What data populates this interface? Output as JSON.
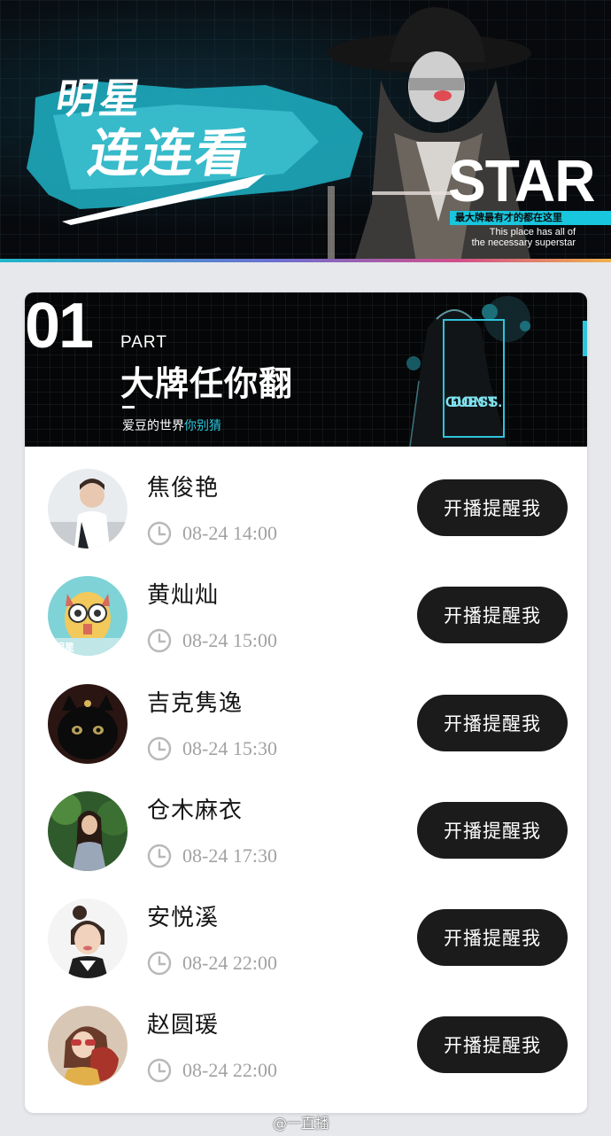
{
  "banner": {
    "title_line1": "明星",
    "title_line2": "连连看",
    "star_word": "STAR",
    "star_sub": "最大牌最有才的都在这里",
    "star_en_line1": "This place has all of",
    "star_en_line2": "the necessary superstar"
  },
  "section": {
    "number": "01",
    "part_label": "PART",
    "title": "大牌任你翻",
    "subtitle_plain": "爱豆的世界",
    "subtitle_highlight": "你别猜",
    "badge_line1": "DON'T",
    "badge_line2": "GUESS."
  },
  "remind_label": "开播提醒我",
  "schedule": [
    {
      "name": "焦俊艳",
      "time": "08-24 14:00",
      "avatar": "avatar-person-1"
    },
    {
      "name": "黄灿灿",
      "time": "08-24 15:00",
      "avatar": "avatar-owl-cartoon"
    },
    {
      "name": "吉克隽逸",
      "time": "08-24 15:30",
      "avatar": "avatar-black-cat"
    },
    {
      "name": "仓木麻衣",
      "time": "08-24 17:30",
      "avatar": "avatar-person-forest"
    },
    {
      "name": "安悦溪",
      "time": "08-24 22:00",
      "avatar": "avatar-person-2"
    },
    {
      "name": "赵圆瑗",
      "time": "08-24 22:00",
      "avatar": "avatar-person-3"
    }
  ],
  "watermark": "@一直播",
  "colors": {
    "accent": "#29c6dc",
    "button_bg": "#1b1b1b",
    "time_text": "#a2a2a2"
  }
}
